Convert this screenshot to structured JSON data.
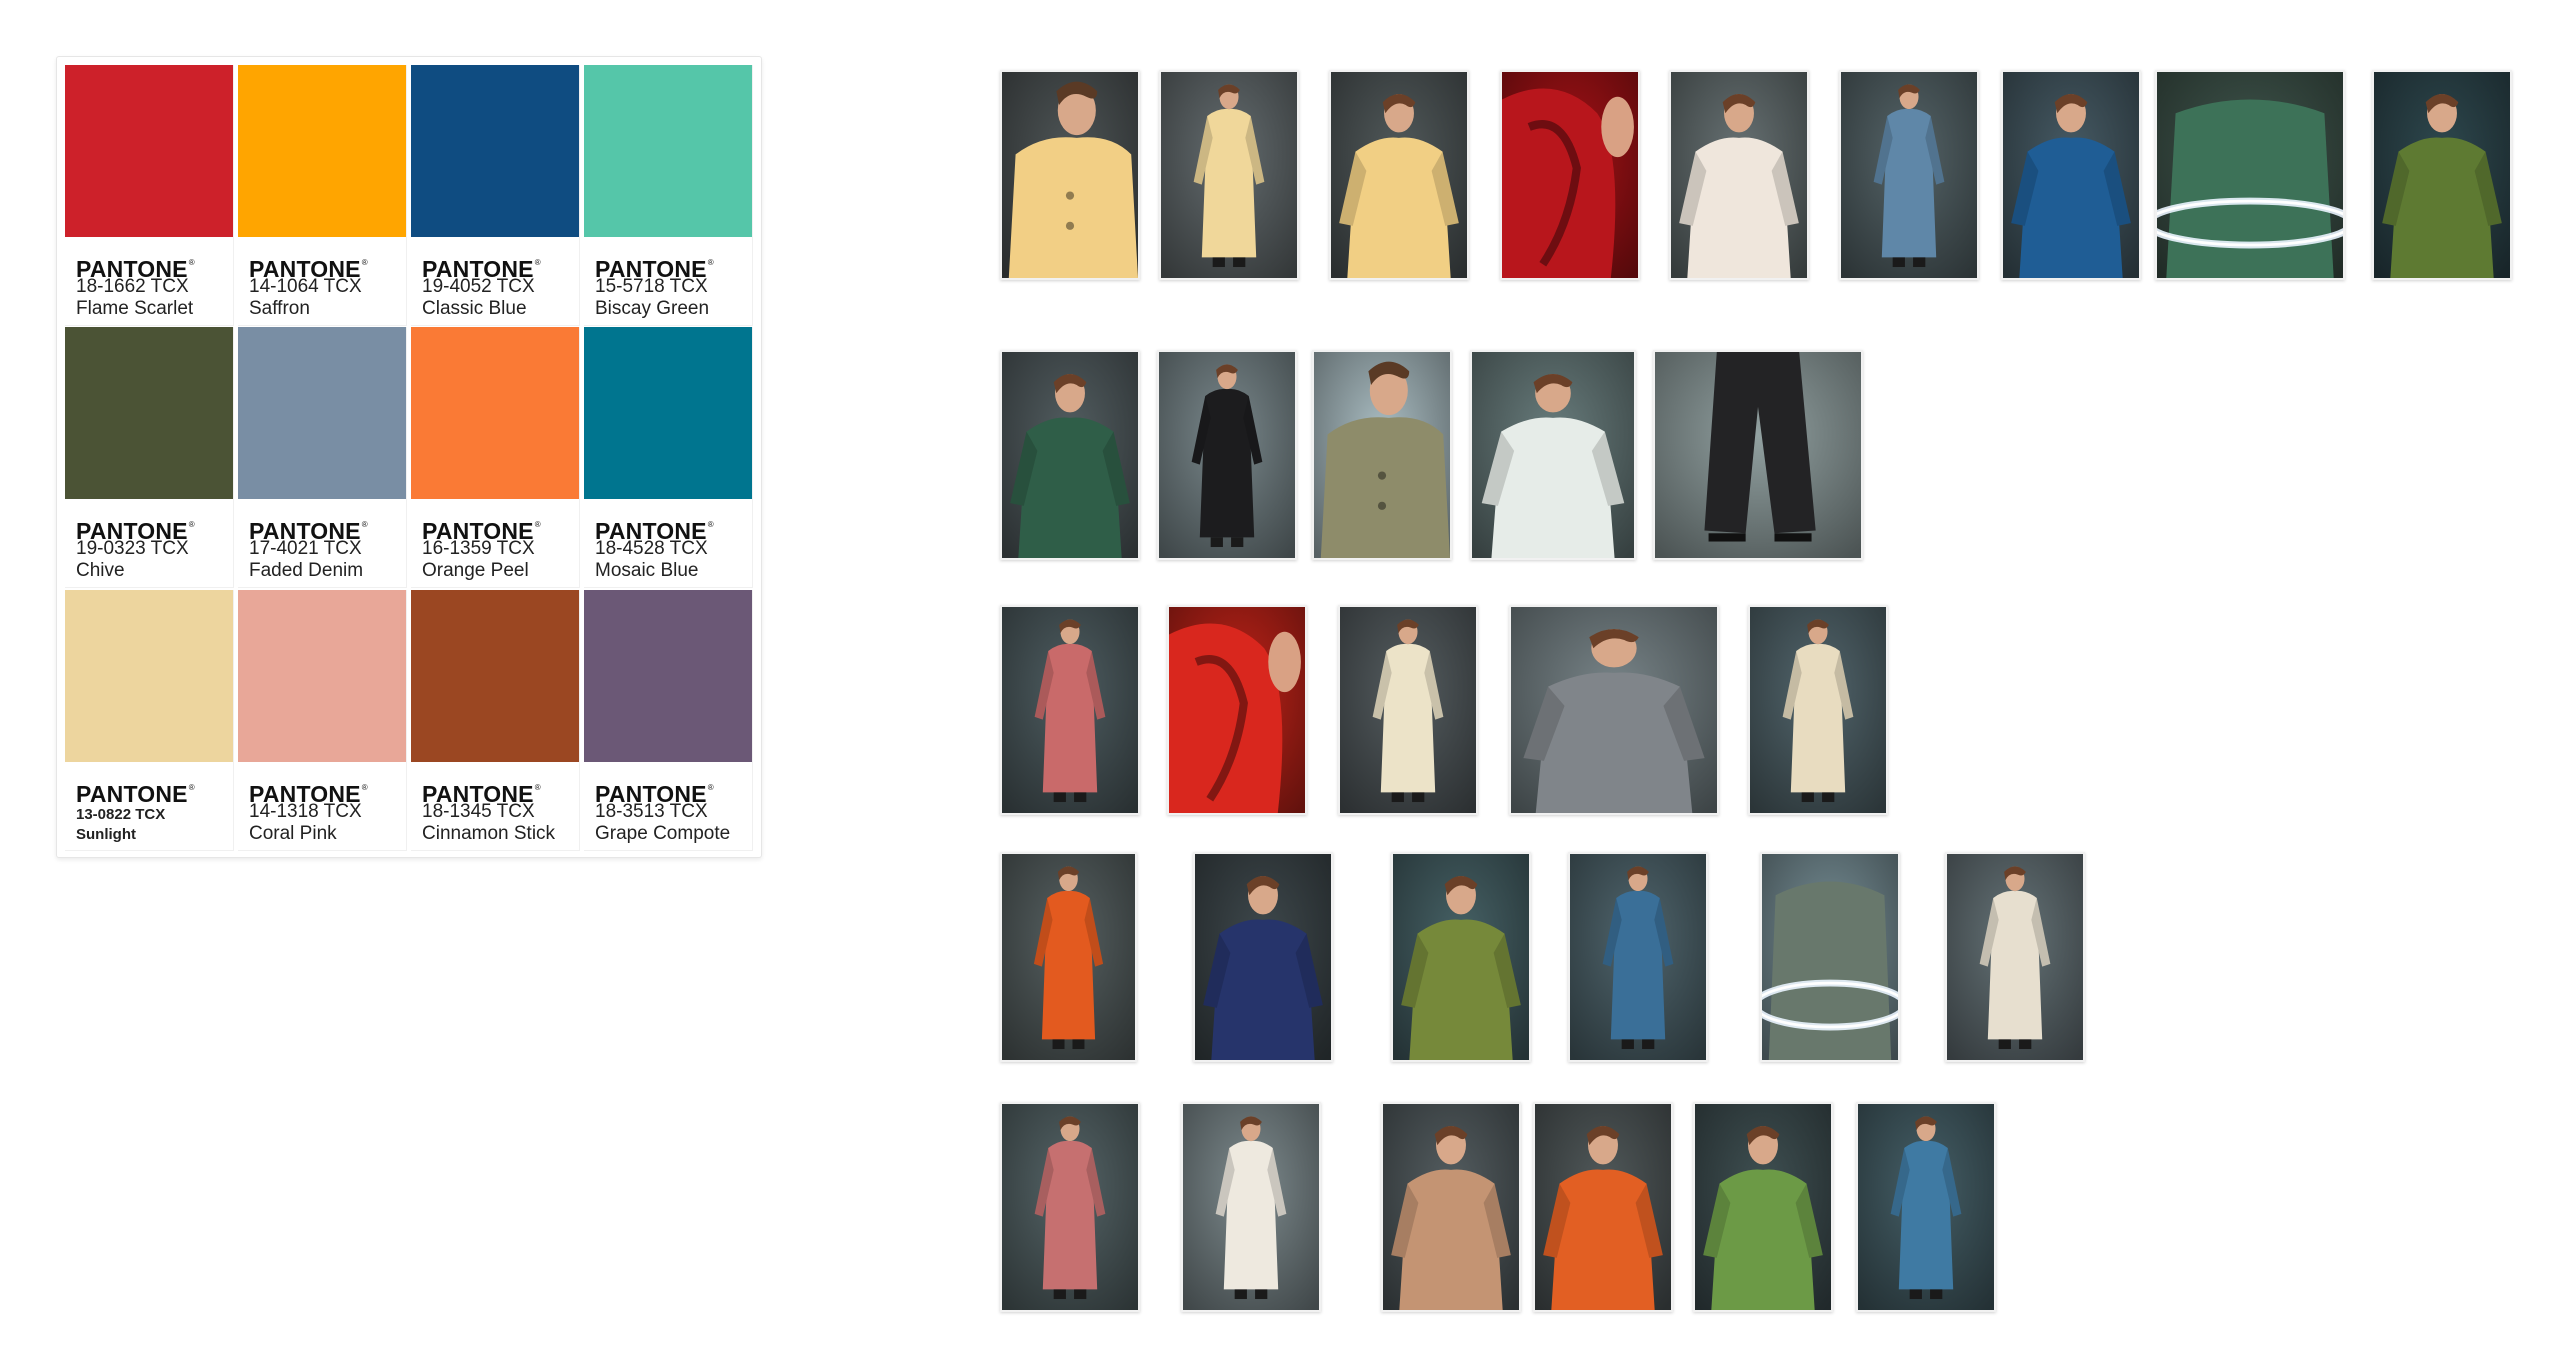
{
  "palette": {
    "chips": [
      {
        "brand": "PANTONE",
        "code": "18-1662 TCX",
        "name": "Flame Scarlet",
        "color": "#CD212A"
      },
      {
        "brand": "PANTONE",
        "code": "14-1064 TCX",
        "name": "Saffron",
        "color": "#FFA500"
      },
      {
        "brand": "PANTONE",
        "code": "19-4052 TCX",
        "name": "Classic Blue",
        "color": "#0F4C81"
      },
      {
        "brand": "PANTONE",
        "code": "15-5718 TCX",
        "name": "Biscay Green",
        "color": "#55C6A9"
      },
      {
        "brand": "PANTONE",
        "code": "19-0323 TCX",
        "name": "Chive",
        "color": "#4B5335"
      },
      {
        "brand": "PANTONE",
        "code": "17-4021 TCX",
        "name": "Faded Denim",
        "color": "#798EA4"
      },
      {
        "brand": "PANTONE",
        "code": "16-1359 TCX",
        "name": "Orange Peel",
        "color": "#FA7A35"
      },
      {
        "brand": "PANTONE",
        "code": "18-4528 TCX",
        "name": "Mosaic Blue",
        "color": "#00758F"
      },
      {
        "brand": "PANTONE",
        "code": "13-0822 TCX",
        "name": "Sunlight",
        "color": "#EDD59E"
      },
      {
        "brand": "PANTONE",
        "code": "14-1318 TCX",
        "name": "Coral Pink",
        "color": "#E8A798"
      },
      {
        "brand": "PANTONE",
        "code": "18-1345 TCX",
        "name": "Cinnamon Stick",
        "color": "#9B4722"
      },
      {
        "brand": "PANTONE",
        "code": "18-3513 TCX",
        "name": "Grape Compote",
        "color": "#6B5876"
      }
    ]
  },
  "photos": [
    {
      "subject": "close-up-saffron-coat",
      "bg": "#3a3f40",
      "garment": "#f2cf85",
      "variant": "closeup"
    },
    {
      "subject": "model-long-saffron-coat",
      "bg": "#4a5052",
      "garment": "#f0d79a",
      "variant": "full"
    },
    {
      "subject": "model-saffron-coat-pose",
      "bg": "#3c4243",
      "garment": "#f1cf84",
      "variant": "half"
    },
    {
      "subject": "red-fabric-closeup",
      "bg": "#7a0d10",
      "garment": "#b8161c",
      "variant": "red"
    },
    {
      "subject": "model-red-floral-jacket",
      "bg": "#4c5455",
      "garment": "#efe6dc",
      "variant": "half"
    },
    {
      "subject": "model-patchwork-blue-coat",
      "bg": "#3f4a4d",
      "garment": "#5f87a8",
      "variant": "full"
    },
    {
      "subject": "model-classic-blue-jacket",
      "bg": "#34434a",
      "garment": "#1f5d95",
      "variant": "half"
    },
    {
      "subject": "light-ring-green-fabric",
      "bg": "#2f3f38",
      "garment": "#3d7258",
      "variant": "ring"
    },
    {
      "subject": "model-green-bolero",
      "bg": "#22353a",
      "garment": "#5e7a32",
      "variant": "half"
    },
    {
      "subject": "model-green-patch-coat",
      "bg": "#3d4547",
      "garment": "#2f5e48",
      "variant": "half"
    },
    {
      "subject": "model-black-suit-fog",
      "bg": "#5a6568",
      "garment": "#1c1c1e",
      "variant": "full"
    },
    {
      "subject": "model-olive-jacket-closeup",
      "bg": "#7e8c90",
      "garment": "#8e8c6a",
      "variant": "closeup"
    },
    {
      "subject": "model-white-blouse-dance",
      "bg": "#4d5c5c",
      "garment": "#e6ece8",
      "variant": "half"
    },
    {
      "subject": "black-trousers-fog",
      "bg": "#6d7878",
      "garment": "#232325",
      "variant": "legs"
    },
    {
      "subject": "model-coral-jacket",
      "bg": "#3a4548",
      "garment": "#c96a6a",
      "variant": "full"
    },
    {
      "subject": "red-sleeve-closeup",
      "bg": "#8e1a12",
      "garment": "#d9271e",
      "variant": "red"
    },
    {
      "subject": "model-cream-coat-scarf",
      "bg": "#3f4547",
      "garment": "#ece3c8",
      "variant": "full"
    },
    {
      "subject": "model-grey-jacquard-jacket",
      "bg": "#596265",
      "garment": "#80858a",
      "variant": "half"
    },
    {
      "subject": "model-green-top-cream-skirt",
      "bg": "#3d4b50",
      "garment": "#e8dcc0",
      "variant": "full"
    },
    {
      "subject": "model-orange-floral-coat",
      "bg": "#404748",
      "garment": "#e35a1f",
      "variant": "full"
    },
    {
      "subject": "model-navy-jacket",
      "bg": "#2e3538",
      "garment": "#26346b",
      "variant": "half"
    },
    {
      "subject": "model-green-cape-cream-skirt",
      "bg": "#34484b",
      "garment": "#76893a",
      "variant": "half"
    },
    {
      "subject": "model-blue-patch-coat-back",
      "bg": "#3b4b51",
      "garment": "#3a6f98",
      "variant": "full"
    },
    {
      "subject": "model-outdoor-light",
      "bg": "#586a6f",
      "garment": "#68786c",
      "variant": "ring"
    },
    {
      "subject": "model-cream-long-coat",
      "bg": "#4b5558",
      "garment": "#e7dfcf",
      "variant": "full"
    },
    {
      "subject": "model-coral-jacket-2",
      "bg": "#3f4a4c",
      "garment": "#c67070",
      "variant": "full"
    },
    {
      "subject": "model-white-long-coat",
      "bg": "#5d6769",
      "garment": "#eee9df",
      "variant": "full"
    },
    {
      "subject": "model-tan-jacket",
      "bg": "#3e4547",
      "garment": "#c49473",
      "variant": "half"
    },
    {
      "subject": "model-orange-hood-coat",
      "bg": "#3c4243",
      "garment": "#e25f23",
      "variant": "half"
    },
    {
      "subject": "model-green-cape-back",
      "bg": "#2f3b3d",
      "garment": "#6c9a46",
      "variant": "half"
    },
    {
      "subject": "model-blue-patch-coat-2",
      "bg": "#33464c",
      "garment": "#3f7aa3",
      "variant": "full"
    }
  ]
}
